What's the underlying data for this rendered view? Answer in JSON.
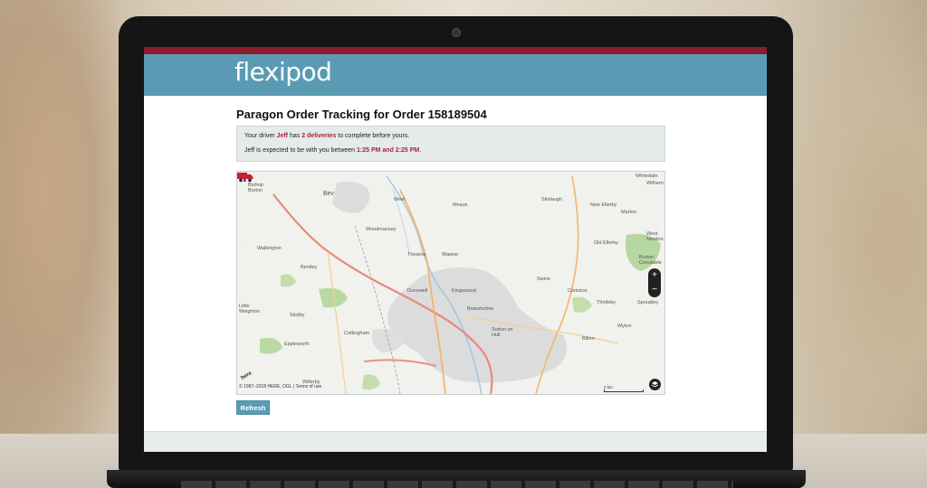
{
  "app": {
    "logo_text": "flexipod"
  },
  "page": {
    "title": "Paragon Order Tracking for Order 158189504"
  },
  "info": {
    "line1_prefix": "Your driver ",
    "driver_name": "Jeff",
    "line1_mid": " has ",
    "deliveries": "2 deliveries",
    "line1_suffix": " to complete before yours.",
    "line2_prefix": "Jeff is expected to be with you between ",
    "window": "1:25 PM and 2:25 PM",
    "line2_suffix": "."
  },
  "map": {
    "places": [
      {
        "label": "Whitedale"
      },
      {
        "label": "Withern"
      },
      {
        "label": "Bishop Burton"
      },
      {
        "label": "Bev"
      },
      {
        "label": "Weel"
      },
      {
        "label": "Skirlaugh"
      },
      {
        "label": "Meaux"
      },
      {
        "label": "New Ellerby"
      },
      {
        "label": "Marton"
      },
      {
        "label": "Woodmansey"
      },
      {
        "label": "West Newton"
      },
      {
        "label": "Walkington"
      },
      {
        "label": "Old Ellerby"
      },
      {
        "label": "Thearne"
      },
      {
        "label": "Wawne"
      },
      {
        "label": "Burton Constable"
      },
      {
        "label": "Bentley"
      },
      {
        "label": "Swine"
      },
      {
        "label": "Dunswell"
      },
      {
        "label": "Kingswood"
      },
      {
        "label": "Coniston"
      },
      {
        "label": "Thirtleby"
      },
      {
        "label": "Sproatley"
      },
      {
        "label": "Little Weighton"
      },
      {
        "label": "Skidby"
      },
      {
        "label": "Bransholme"
      },
      {
        "label": "Wyton"
      },
      {
        "label": "Cottingham"
      },
      {
        "label": "Sutton on Hull"
      },
      {
        "label": "Bilton"
      },
      {
        "label": "Eppleworth"
      },
      {
        "label": "Willerby"
      }
    ],
    "copyright": "© 1987–2018 HERE, OGL | Terms of use",
    "scale_label": "2 km",
    "here_logo": "here",
    "zoom_in": "+",
    "zoom_out": "−",
    "icons": {
      "home": "home-icon",
      "truck": "truck-icon",
      "layers": "layers-icon"
    }
  },
  "actions": {
    "refresh_label": "Refresh"
  },
  "colors": {
    "header": "#5a9bb3",
    "stripe": "#8c1c2e",
    "highlight": "#b0213a"
  }
}
